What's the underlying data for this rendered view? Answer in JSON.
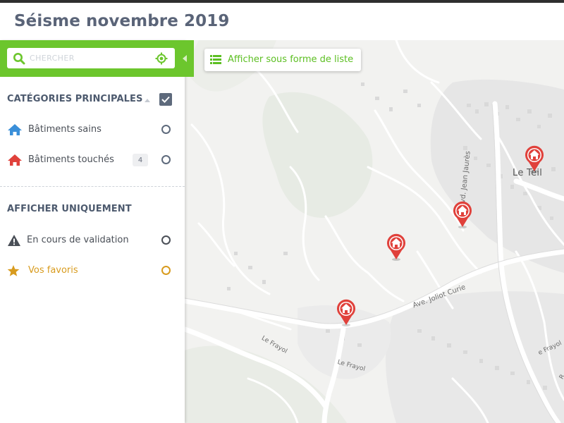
{
  "app": {
    "title": "Séisme novembre 2019"
  },
  "search": {
    "placeholder": "CHERCHER",
    "value": ""
  },
  "list_button": {
    "label": "Afficher sous forme de liste"
  },
  "categories": {
    "title": "CATÉGORIES PRINCIPALES",
    "checked": true,
    "items": [
      {
        "label": "Bâtiments sains",
        "icon": "home-icon",
        "color": "#3a8fd9",
        "count": ""
      },
      {
        "label": "Bâtiments touchés",
        "icon": "home-icon",
        "color": "#e0413b",
        "count": "4"
      }
    ]
  },
  "filters": {
    "title": "AFFICHER UNIQUEMENT",
    "items": [
      {
        "label": "En cours de validation",
        "icon": "warning-icon",
        "color": "#4a4f57"
      },
      {
        "label": "Vos favoris",
        "icon": "star-icon",
        "color": "#d89b1e"
      }
    ]
  },
  "map": {
    "labels": {
      "town": "Le Teil",
      "road_jaures": "Blvd. Jean Jaurès",
      "road_joliot": "Ave. Joliot Curie",
      "road_frayol1": "Le Frayol",
      "road_frayol2": "Le Frayol",
      "road_right": "e Frayol",
      "road_corner": "R"
    },
    "markers": [
      {
        "name": "damaged-building-marker",
        "color": "#e0413b"
      },
      {
        "name": "damaged-building-marker",
        "color": "#e0413b"
      },
      {
        "name": "damaged-building-marker",
        "color": "#e0413b"
      },
      {
        "name": "damaged-building-marker",
        "color": "#e0413b"
      }
    ]
  },
  "colors": {
    "accent_green": "#6cc62d",
    "title_slate": "#5a6478",
    "marker_red": "#e0413b",
    "healthy_blue": "#3a8fd9",
    "favorite_gold": "#d89b1e"
  }
}
